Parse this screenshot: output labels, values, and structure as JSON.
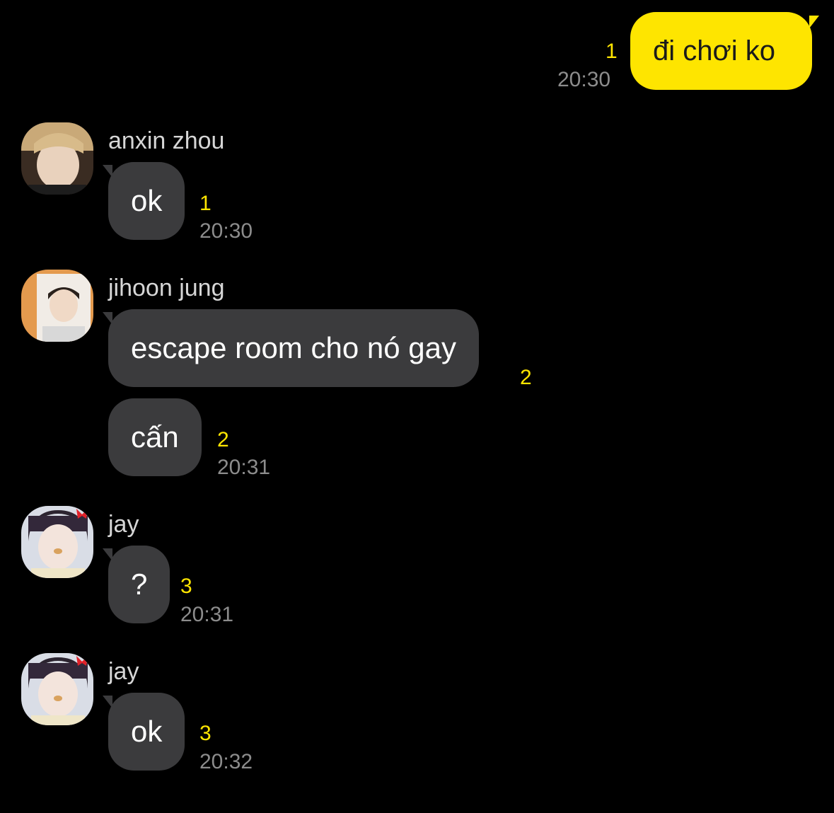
{
  "outgoing": {
    "text": "đi chơi ko",
    "unread": "1",
    "time": "20:30"
  },
  "messages": [
    {
      "sender": "anxin zhou",
      "text": "ok",
      "unread": "1",
      "time": "20:30"
    },
    {
      "sender": "jihoon jung",
      "text": "escape room cho nó gay",
      "unread": "2"
    },
    {
      "text": "cấn",
      "unread": "2",
      "time": "20:31"
    },
    {
      "sender": "jay",
      "text": "?",
      "unread": "3",
      "time": "20:31"
    },
    {
      "sender": "jay",
      "text": "ok",
      "unread": "3",
      "time": "20:32"
    }
  ],
  "colors": {
    "background": "#000000",
    "outgoing_bubble": "#FEE500",
    "incoming_bubble": "#3B3B3D",
    "unread_count": "#FEE500",
    "timestamp": "#8C8C8C"
  }
}
